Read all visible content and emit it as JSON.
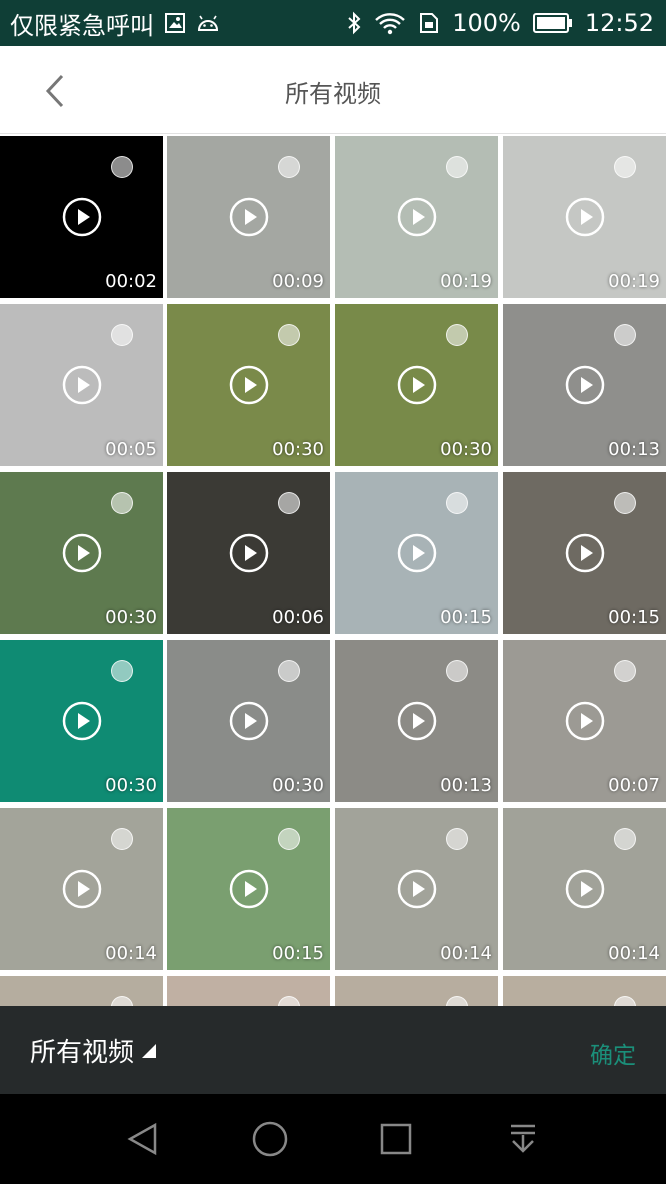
{
  "status_bar": {
    "carrier": "仅限紧急呼叫",
    "battery": "100%",
    "time": "12:52"
  },
  "header": {
    "title": "所有视频"
  },
  "bottom_bar": {
    "album": "所有视频",
    "confirm": "确定"
  },
  "colors": {
    "status_bg": "#0f3e36",
    "accent": "#1b8f7a",
    "bottom_bg": "#262a2b"
  },
  "videos": [
    {
      "duration": "00:02",
      "bg": "#000000"
    },
    {
      "duration": "00:09",
      "bg": "#a4a7a2"
    },
    {
      "duration": "00:19",
      "bg": "#b4bdb4"
    },
    {
      "duration": "00:19",
      "bg": "#c5c7c4"
    },
    {
      "duration": "00:05",
      "bg": "#bcbcbc"
    },
    {
      "duration": "00:30",
      "bg": "#7a8a4a"
    },
    {
      "duration": "00:30",
      "bg": "#788a49"
    },
    {
      "duration": "00:13",
      "bg": "#8f8f8c"
    },
    {
      "duration": "00:30",
      "bg": "#5e7a4f"
    },
    {
      "duration": "00:06",
      "bg": "#3b3a35"
    },
    {
      "duration": "00:15",
      "bg": "#a8b3b6"
    },
    {
      "duration": "00:15",
      "bg": "#6e6a62"
    },
    {
      "duration": "00:30",
      "bg": "#0f8b73"
    },
    {
      "duration": "00:30",
      "bg": "#8a8c89"
    },
    {
      "duration": "00:13",
      "bg": "#8c8b86"
    },
    {
      "duration": "00:07",
      "bg": "#9c9a94"
    },
    {
      "duration": "00:14",
      "bg": "#a3a49a"
    },
    {
      "duration": "00:15",
      "bg": "#7a9f70"
    },
    {
      "duration": "00:14",
      "bg": "#a2a39a"
    },
    {
      "duration": "00:14",
      "bg": "#a1a299"
    },
    {
      "duration": "",
      "bg": "#b5ad9f"
    },
    {
      "duration": "",
      "bg": "#c0b0a3"
    },
    {
      "duration": "",
      "bg": "#b7ad9f"
    },
    {
      "duration": "",
      "bg": "#b8ae9f"
    }
  ]
}
